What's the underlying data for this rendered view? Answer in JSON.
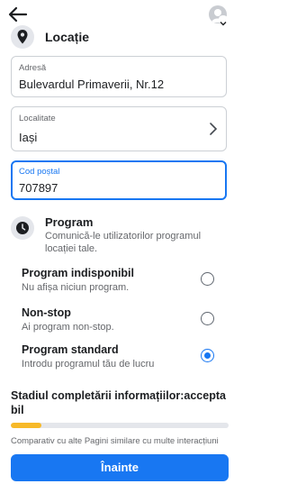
{
  "header": {
    "back_icon": "arrow-left-icon",
    "avatar_icon": "profile-avatar-icon"
  },
  "location": {
    "title": "Locație",
    "icon": "map-pin-icon",
    "address": {
      "label": "Adresă",
      "value": "Bulevardul Primaverii, Nr.12"
    },
    "city": {
      "label": "Localitate",
      "value": "Iași"
    },
    "postal": {
      "label": "Cod poștal",
      "value": "707897"
    }
  },
  "program": {
    "title": "Program",
    "icon": "clock-icon",
    "description": "Comunică-le utilizatorilor programul locației tale.",
    "options": [
      {
        "title": "Program indisponibil",
        "desc": "Nu afișa niciun program.",
        "selected": false
      },
      {
        "title": "Non-stop",
        "desc": "Ai program non-stop.",
        "selected": false
      },
      {
        "title": "Program standard",
        "desc": "Introdu programul tău de lucru",
        "selected": true
      }
    ]
  },
  "completion": {
    "status_text": "Stadiul completării informațiilor:acceptabil",
    "progress_fraction": 0.14,
    "progress_color": "#f7b928",
    "compare_text": "Comparativ cu alte Pagini similare cu multe interacțiuni"
  },
  "footer": {
    "next_label": "Înainte",
    "accent": "#1877f2"
  }
}
